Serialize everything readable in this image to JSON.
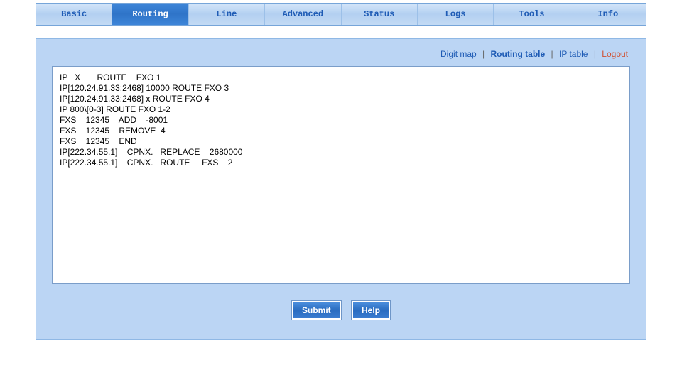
{
  "nav": {
    "tabs": [
      {
        "label": "Basic",
        "active": false
      },
      {
        "label": "Routing",
        "active": true
      },
      {
        "label": "Line",
        "active": false
      },
      {
        "label": "Advanced",
        "active": false
      },
      {
        "label": "Status",
        "active": false
      },
      {
        "label": "Logs",
        "active": false
      },
      {
        "label": "Tools",
        "active": false
      },
      {
        "label": "Info",
        "active": false
      }
    ]
  },
  "subnav": {
    "digit_map": "Digit map",
    "routing_table": "Routing table",
    "ip_table": "IP table",
    "logout": "Logout"
  },
  "routing_text": "IP   X       ROUTE    FXO 1\nIP[120.24.91.33:2468] 10000 ROUTE FXO 3\nIP[120.24.91.33:2468] x ROUTE FXO 4\nIP 800\\[0-3] ROUTE FXO 1-2\nFXS    12345    ADD    -8001\nFXS    12345    REMOVE  4\nFXS    12345    END\nIP[222.34.55.1]    CPNX.   REPLACE    2680000\nIP[222.34.55.1]    CPNX.   ROUTE     FXS    2",
  "buttons": {
    "submit": "Submit",
    "help": "Help"
  }
}
